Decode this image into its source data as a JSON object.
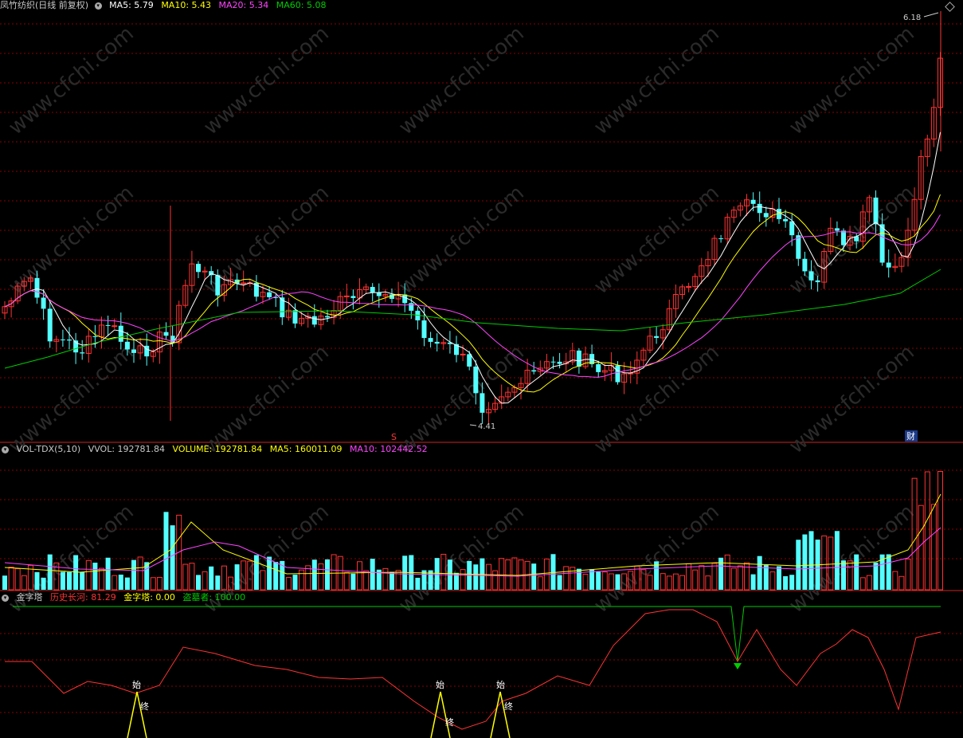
{
  "main_panel": {
    "title": "凤竹纺织(日线 前复权)",
    "ma5": {
      "label": "MA5: 5.79",
      "color": "#ffffff"
    },
    "ma10": {
      "label": "MA10: 5.43",
      "color": "#ffff00"
    },
    "ma20": {
      "label": "MA20: 5.34",
      "color": "#ff44ff"
    },
    "ma60": {
      "label": "MA60: 5.08",
      "color": "#00cc00"
    },
    "high_label": "6.18",
    "low_label": "4.41",
    "marker_s": "S",
    "marker_cai": "财"
  },
  "volume_panel": {
    "title": "VOL-TDX(5,10)",
    "vvol": "VVOL: 192781.84",
    "volume": "VOLUME: 192781.84",
    "ma5": "MA5: 160011.09",
    "ma10": "MA10: 102442.52"
  },
  "indicator_panel": {
    "title": "金字塔",
    "history": "历史长河: 81.29",
    "pyramid": "金字塔: 0.00",
    "thief": "盗墓者: 100.00",
    "marks": [
      {
        "start": "始",
        "end": "终"
      },
      {
        "start": "始",
        "end": "终"
      },
      {
        "start": "始",
        "end": "终"
      }
    ]
  },
  "watermark": "www.cfchi.com",
  "colors": {
    "up": "#ff3333",
    "down": "#54ffff",
    "grid": "#8b0000",
    "ma5": "#ffffff",
    "ma10": "#ffff00",
    "ma20": "#ff44ff",
    "ma60": "#00cc00"
  }
}
